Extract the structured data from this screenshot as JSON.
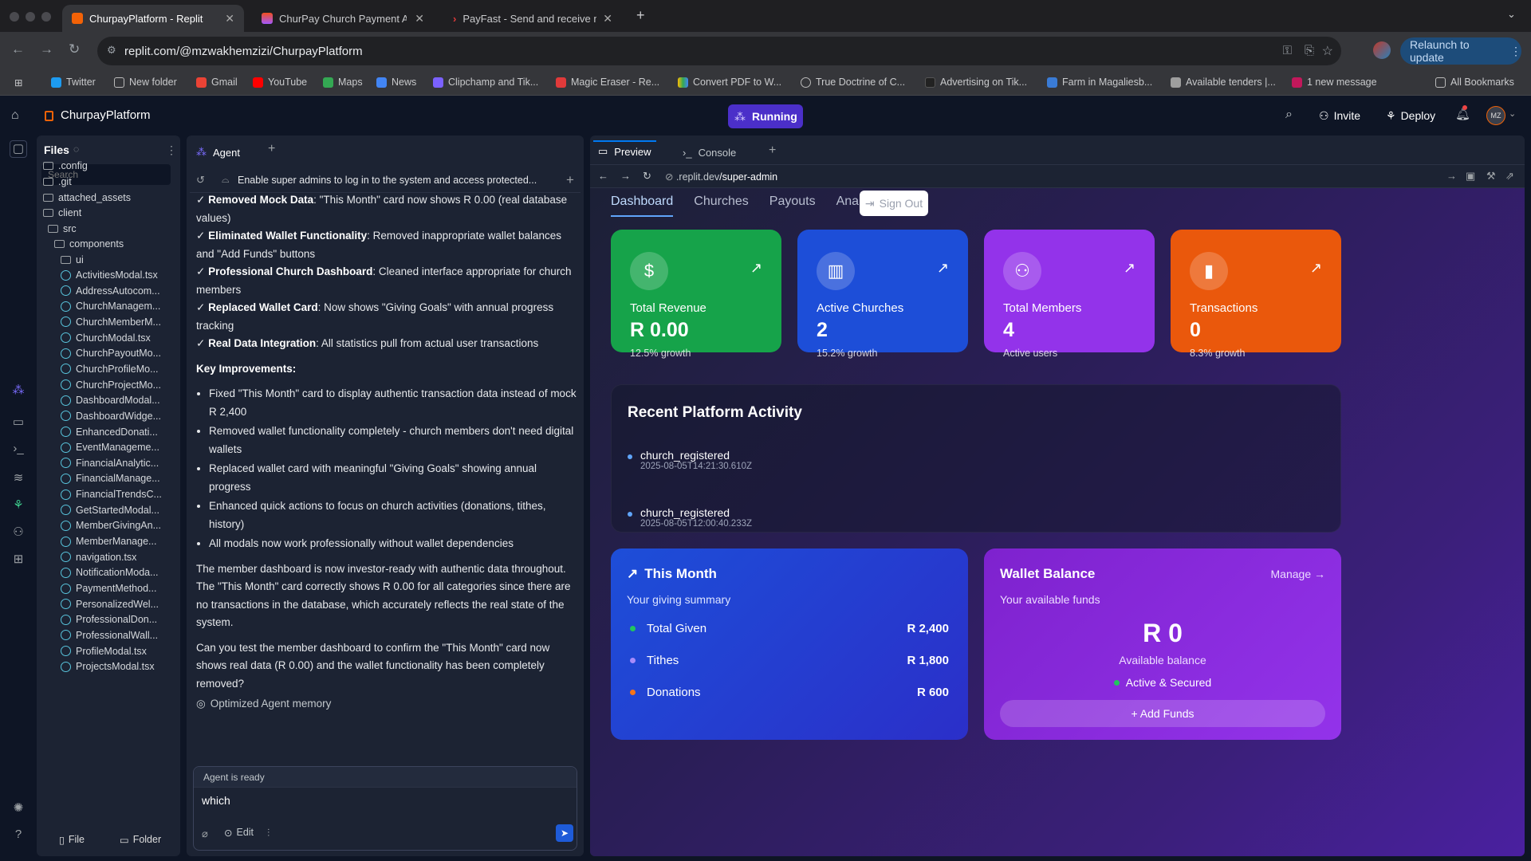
{
  "browser": {
    "tabs": [
      {
        "label": "ChurpayPlatform - Replit"
      },
      {
        "label": "ChurPay Church Payment Ap"
      },
      {
        "label": "PayFast - Send and receive m"
      }
    ],
    "url": "replit.com/@mzwakhemzizi/ChurpayPlatform",
    "relaunch": "Relaunch to update",
    "bookmarks": [
      "Twitter",
      "New folder",
      "Gmail",
      "YouTube",
      "Maps",
      "News",
      "Clipchamp and Tik...",
      "Magic Eraser - Re...",
      "Convert PDF to W...",
      "True Doctrine of C...",
      "Advertising on Tik...",
      "Farm in Magaliesb...",
      "Available tenders |...",
      "1 new message"
    ],
    "all_bookmarks": "All Bookmarks"
  },
  "replit": {
    "project": "ChurpayPlatform",
    "run_status": "Running",
    "invite": "Invite",
    "deploy": "Deploy",
    "avatar": "MZ",
    "files": {
      "title": "Files",
      "search_placeholder": "Search",
      "tree": [
        ".config",
        ".git",
        "attached_assets",
        "client",
        "src",
        "components",
        "ui"
      ],
      "files": [
        "ActivitiesModal.tsx",
        "AddressAutocom...",
        "ChurchManagem...",
        "ChurchMemberM...",
        "ChurchModal.tsx",
        "ChurchPayoutMo...",
        "ChurchProfileMo...",
        "ChurchProjectMo...",
        "DashboardModal...",
        "DashboardWidge...",
        "EnhancedDonati...",
        "EventManageme...",
        "FinancialAnalytic...",
        "FinancialManage...",
        "FinancialTrendsC...",
        "GetStartedModal...",
        "MemberGivingAn...",
        "MemberManage...",
        "navigation.tsx",
        "NotificationModa...",
        "PaymentMethod...",
        "PersonalizedWel...",
        "ProfessionalDon...",
        "ProfessionalWall...",
        "ProfileModal.tsx",
        "ProjectsModal.tsx"
      ],
      "new_file": "File",
      "new_folder": "Folder"
    },
    "agent": {
      "tab": "Agent",
      "thread_title": "Enable super admins to log in to the system and access protected...",
      "checks": [
        {
          "bold": "Removed Mock Data",
          "text": ": \"This Month\" card now shows R 0.00 (real database values)"
        },
        {
          "bold": "Eliminated Wallet Functionality",
          "text": ": Removed inappropriate wallet balances and \"Add Funds\" buttons"
        },
        {
          "bold": "Professional Church Dashboard",
          "text": ": Cleaned interface appropriate for church members"
        },
        {
          "bold": "Replaced Wallet Card",
          "text": ": Now shows \"Giving Goals\" with annual progress tracking"
        },
        {
          "bold": "Real Data Integration",
          "text": ": All statistics pull from actual user transactions"
        }
      ],
      "improvements_title": "Key Improvements:",
      "improvements": [
        "Fixed \"This Month\" card to display authentic transaction data instead of mock R 2,400",
        "Removed wallet functionality completely - church members don't need digital wallets",
        "Replaced wallet card with meaningful \"Giving Goals\" showing annual progress",
        "Enhanced quick actions to focus on church activities (donations, tithes, history)",
        "All modals now work professionally without wallet dependencies"
      ],
      "para1": "The member dashboard is now investor-ready with authentic data throughout. The \"This Month\" card correctly shows R 0.00 for all categories since there are no transactions in the database, which accurately reflects the real state of the system.",
      "para2": "Can you test the member dashboard to confirm the \"This Month\" card now shows real data (R 0.00) and the wallet functionality has been completely removed?",
      "memory": "Optimized Agent memory",
      "status": "Agent is ready",
      "input_value": "which",
      "edit": "Edit"
    },
    "preview": {
      "tab_preview": "Preview",
      "tab_console": "Console",
      "url_host": ".replit.dev",
      "url_path": "/super-admin"
    }
  },
  "site": {
    "nav": [
      "Dashboard",
      "Churches",
      "Payouts",
      "Analytics"
    ],
    "sign_out": "Sign Out",
    "stats": [
      {
        "label": "Total Revenue",
        "value": "R 0.00",
        "sub": "12.5% growth",
        "icon": "dollar-icon",
        "color": "#16a34a"
      },
      {
        "label": "Active Churches",
        "value": "2",
        "sub": "15.2% growth",
        "icon": "building-icon",
        "color": "#1d4ed8"
      },
      {
        "label": "Total Members",
        "value": "4",
        "sub": "Active users",
        "icon": "users-icon",
        "color": "#9333ea"
      },
      {
        "label": "Transactions",
        "value": "0",
        "sub": "8.3% growth",
        "icon": "bar-chart-icon",
        "color": "#ea580c"
      }
    ],
    "activity": {
      "title": "Recent Platform Activity",
      "items": [
        {
          "event": "church_registered",
          "time": "2025-08-05T14:21:30.610Z"
        },
        {
          "event": "church_registered",
          "time": "2025-08-05T12:00:40.233Z"
        }
      ]
    },
    "this_month": {
      "title": "This Month",
      "subtitle": "Your giving summary",
      "rows": [
        {
          "label": "Total Given",
          "amount": "R 2,400",
          "color": "#22c55e"
        },
        {
          "label": "Tithes",
          "amount": "R 1,800",
          "color": "#a78bfa"
        },
        {
          "label": "Donations",
          "amount": "R 600",
          "color": "#f97316"
        }
      ]
    },
    "wallet": {
      "title": "Wallet Balance",
      "manage": "Manage →",
      "subtitle": "Your available funds",
      "amount": "R 0",
      "amount_label": "Available balance",
      "status": "Active & Secured",
      "add_funds": "+ Add Funds"
    }
  }
}
